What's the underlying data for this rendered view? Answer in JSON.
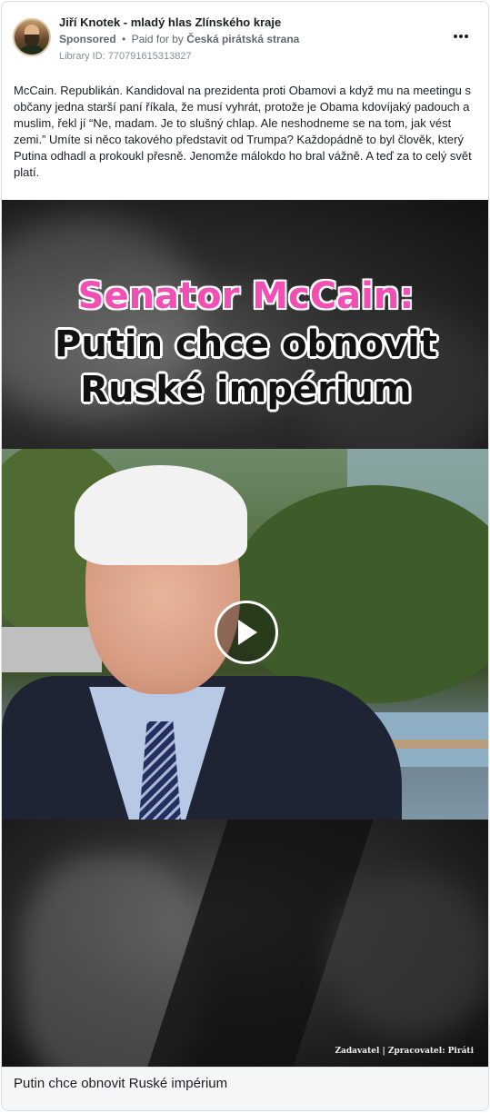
{
  "ad": {
    "page_name": "Jiří Knotek - mladý hlas Zlínského kraje",
    "sponsored_label": "Sponsored",
    "separator": "•",
    "paid_for_prefix": "Paid for by",
    "payer": "Česká pirátská strana",
    "library_id": "Library ID: 770791615313827",
    "more_icon": "more-horizontal-icon"
  },
  "post": {
    "text": "McCain. Republikán. Kandidoval na prezidenta proti Obamovi a když mu na meetingu s občany jedna starší paní říkala, že musí vyhrát, protože je Obama kdovíjaký padouch a muslim, řekl jí “Ne, madam. Je to slušný chlap. Ale neshodneme se na tom, jak vést zemi.” Umíte si něco takového představit od Trumpa? Každopádně to byl člověk, který Putina odhadl a prokoukl přesně. Jenomže málokdo ho bral vážně. A teď za to celý svět platí."
  },
  "video": {
    "overlay_title": "Senator McCain:",
    "overlay_line1": "Putin chce obnovit",
    "overlay_line2": "Ruské impérium",
    "credit": "Zadavatel | Zpracovatel: Piráti",
    "play_icon": "play-icon",
    "colors": {
      "title_pink": "#f14fb4",
      "outline": "#ffffff"
    }
  },
  "caption": {
    "text": "Putin chce obnovit Ruské impérium"
  }
}
